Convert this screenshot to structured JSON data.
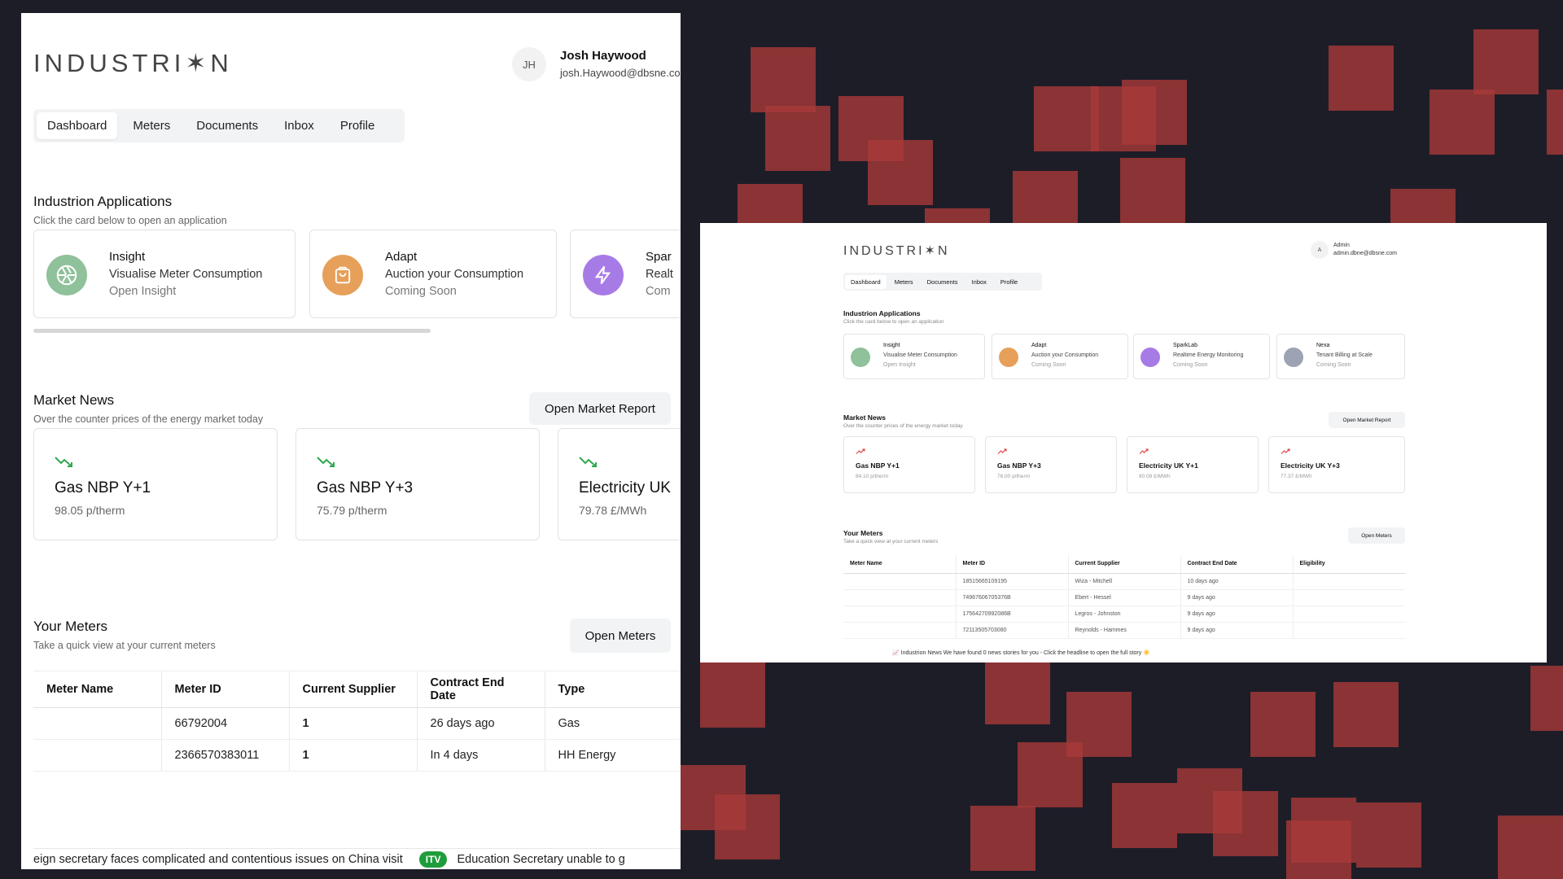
{
  "brand": {
    "logo_text": "INDUSTRI✶N"
  },
  "user": {
    "initials": "JH",
    "name": "Josh Haywood",
    "email": "josh.Haywood@dbsne.com"
  },
  "nav": {
    "tabs": [
      "Dashboard",
      "Meters",
      "Documents",
      "Inbox",
      "Profile"
    ],
    "active": "Dashboard"
  },
  "applications": {
    "title": "Industrion Applications",
    "subtitle": "Click the card below to open an application",
    "cards": [
      {
        "name": "Insight",
        "description": "Visualise Meter Consumption",
        "status": "Open Insight",
        "color": "#8fc19a",
        "icon": "aperture-icon"
      },
      {
        "name": "Adapt",
        "description": "Auction your Consumption",
        "status": "Coming Soon",
        "color": "#e6a05a",
        "icon": "bag-icon"
      },
      {
        "name": "Spar",
        "description": "Realt",
        "status": "Com",
        "color": "#a77be6",
        "icon": "lightning-icon"
      }
    ]
  },
  "market_news": {
    "title": "Market News",
    "subtitle": "Over the counter prices of the energy market today",
    "button": "Open Market Report",
    "trend_color": "#2fa84f",
    "cards": [
      {
        "name": "Gas NBP Y+1",
        "price": "98.05 p/therm"
      },
      {
        "name": "Gas NBP Y+3",
        "price": "75.79 p/therm"
      },
      {
        "name": "Electricity UK",
        "price": "79.78 £/MWh"
      }
    ]
  },
  "meters": {
    "title": "Your Meters",
    "subtitle": "Take a quick view at your current meters",
    "button": "Open Meters",
    "columns": [
      "Meter Name",
      "Meter ID",
      "Current Supplier",
      "Contract End Date",
      "Type"
    ],
    "rows": [
      [
        "",
        "66792004",
        "1",
        "26 days ago",
        "Gas"
      ],
      [
        "",
        "2366570383011",
        "1",
        "In 4 days",
        "HH Energy"
      ]
    ]
  },
  "ticker": {
    "text1": "eign secretary faces complicated and contentious issues on China visit",
    "badge": "ITV",
    "text2": "Education Secretary unable to g"
  },
  "preview": {
    "logo_text": "INDUSTRI✶N",
    "user_initial": "A",
    "user_name": "Admin",
    "user_email": "admin.dbne@dbsne.com",
    "tabs": [
      "Dashboard",
      "Meters",
      "Documents",
      "Inbox",
      "Profile"
    ],
    "apps_title": "Industrion Applications",
    "apps_subtitle": "Click the card below to open an application",
    "apps": [
      {
        "name": "Insight",
        "description": "Visualise Meter Consumption",
        "status": "Open Insight",
        "color": "#8fc19a"
      },
      {
        "name": "Adapt",
        "description": "Auction your Consumption",
        "status": "Coming Soon",
        "color": "#e6a05a"
      },
      {
        "name": "SparkLab",
        "description": "Realtime Energy Monitoring",
        "status": "Coming Soon",
        "color": "#a77be6"
      },
      {
        "name": "Nexa",
        "description": "Tenant Billing at Scale",
        "status": "Coming Soon",
        "color": "#9ea3b3"
      }
    ],
    "news_title": "Market News",
    "news_subtitle": "Over the counter prices of the energy market today",
    "news_button": "Open Market Report",
    "news": [
      {
        "name": "Gas NBP Y+1",
        "price": "84.10 p/therm"
      },
      {
        "name": "Gas NBP Y+3",
        "price": "76.00 p/therm"
      },
      {
        "name": "Electricity UK Y+1",
        "price": "80.08 £/MWh"
      },
      {
        "name": "Electricity UK Y+3",
        "price": "77.37 £/MWh"
      }
    ],
    "trend_color": "#e04a4a",
    "meters_title": "Your Meters",
    "meters_subtitle": "Take a quick view at your current meters",
    "meters_button": "Open Meters",
    "columns": [
      "Meter Name",
      "Meter ID",
      "Current Supplier",
      "Contract End Date",
      "Eligibility"
    ],
    "rows": [
      [
        "",
        "18515665109195",
        "Wiza - Mitchell",
        "10 days ago",
        ""
      ],
      [
        "",
        "74967606705376B",
        "Ebert - Hessel",
        "9 days ago",
        ""
      ],
      [
        "",
        "17564270992086B",
        "Legros - Johnston",
        "9 days ago",
        ""
      ],
      [
        "",
        "72113505703080",
        "Reynolds - Hammes",
        "9 days ago",
        ""
      ]
    ],
    "ticker": "📈 Industrion News    We have found 0 news stories for you - Click the headline to open the full story ☀️"
  }
}
